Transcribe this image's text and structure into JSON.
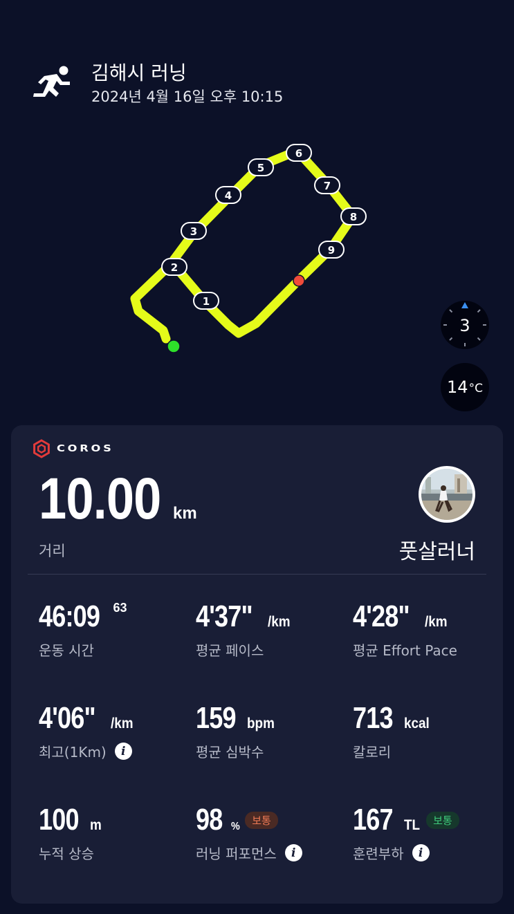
{
  "header": {
    "title": "김해시 러닝",
    "datetime": "2024년 4월 16일 오후 10:15",
    "activity_icon": "running-icon"
  },
  "map": {
    "laps": [
      "1",
      "2",
      "3",
      "4",
      "5",
      "6",
      "7",
      "8",
      "9"
    ],
    "route_color": "#e5fb1a",
    "start_color": "#2ee02a",
    "end_color": "#f04b3a"
  },
  "widgets": {
    "wind_level": "3",
    "temperature": "14",
    "temperature_unit": "°C"
  },
  "brand": "COROS",
  "summary": {
    "distance": "10.00",
    "distance_unit": "km",
    "distance_label": "거리",
    "username": "풋살러너"
  },
  "stats": {
    "duration": {
      "value": "46:09",
      "sup": "63",
      "label": "운동 시간"
    },
    "avg_pace": {
      "value": "4'37\"",
      "unit": "/km",
      "label": "평균 페이스"
    },
    "effort_pace": {
      "value": "4'28\"",
      "unit": "/km",
      "label": "평균 Effort Pace"
    },
    "best_km": {
      "value": "4'06\"",
      "unit": "/km",
      "label": "최고(1Km)"
    },
    "avg_hr": {
      "value": "159",
      "unit": "bpm",
      "label": "평균 심박수"
    },
    "calories": {
      "value": "713",
      "unit": "kcal",
      "label": "칼로리"
    },
    "elevation": {
      "value": "100",
      "unit": "m",
      "label": "누적 상승"
    },
    "performance": {
      "value": "98",
      "unit": "%",
      "badge": "보통",
      "label": "러닝 퍼포먼스"
    },
    "training_load": {
      "value": "167",
      "unit": "TL",
      "badge": "보통",
      "label": "훈련부하"
    }
  },
  "info_glyph": "i",
  "colors": {
    "background": "#0c1128",
    "card": "#191e36",
    "badge_orange": "#f07a55",
    "badge_green": "#3fcc7c"
  }
}
